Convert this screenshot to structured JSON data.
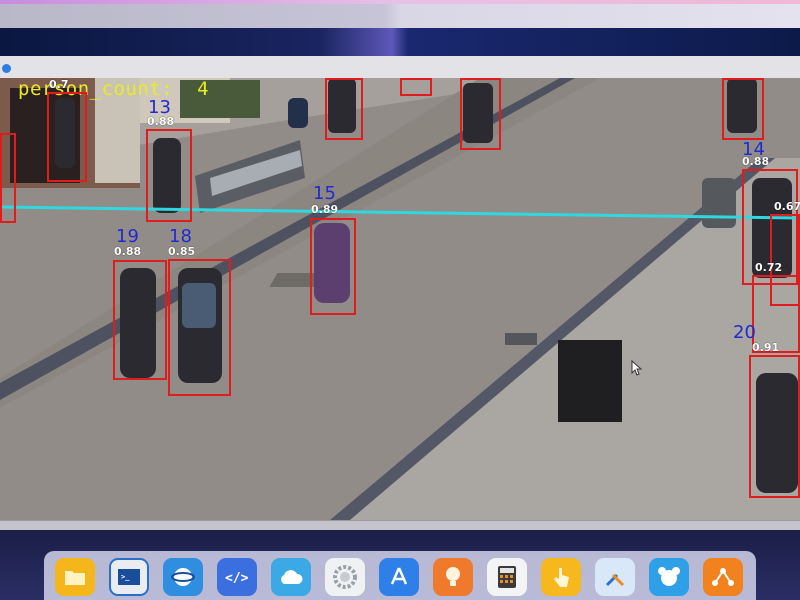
{
  "overlay": {
    "count_text": "person_count:  4"
  },
  "tracks": [
    {
      "id": "",
      "conf": "0.7"
    },
    {
      "id": "13",
      "conf": "0.88"
    },
    {
      "id": "15",
      "conf": "0.89"
    },
    {
      "id": "19",
      "conf": "0.88"
    },
    {
      "id": "18",
      "conf": "0.85"
    },
    {
      "id": "14",
      "conf": "0.88"
    },
    {
      "id": "",
      "conf": "0.67"
    },
    {
      "id": "",
      "conf": "0.72"
    },
    {
      "id": "20",
      "conf": "0.91"
    }
  ],
  "colors": {
    "box": "#e01c1c",
    "track_id": "#1f2bd0",
    "count_line": "#2fd8e0",
    "count_text": "#e9ec22",
    "window_dot": "#2f7de1"
  },
  "dock": {
    "icons": [
      {
        "name": "files-icon",
        "color": "#f4b61a"
      },
      {
        "name": "terminal-icon",
        "color": "#2a6fc9"
      },
      {
        "name": "browser-icon",
        "color": "#2f8ee0"
      },
      {
        "name": "code-editor-icon",
        "color": "#3b6fe0"
      },
      {
        "name": "cloud-icon",
        "color": "#3aa9e6"
      },
      {
        "name": "settings-icon",
        "color": "#cfd3da"
      },
      {
        "name": "app-store-icon",
        "color": "#2f7fe8"
      },
      {
        "name": "tips-icon",
        "color": "#f07a2c"
      },
      {
        "name": "calculator-icon",
        "color": "#e6e6e6"
      },
      {
        "name": "touch-icon",
        "color": "#f6b81c"
      },
      {
        "name": "tools-icon",
        "color": "#4b8fe6"
      },
      {
        "name": "assistant-icon",
        "color": "#2ea0e8"
      },
      {
        "name": "share-icon",
        "color": "#f2821e"
      }
    ]
  }
}
